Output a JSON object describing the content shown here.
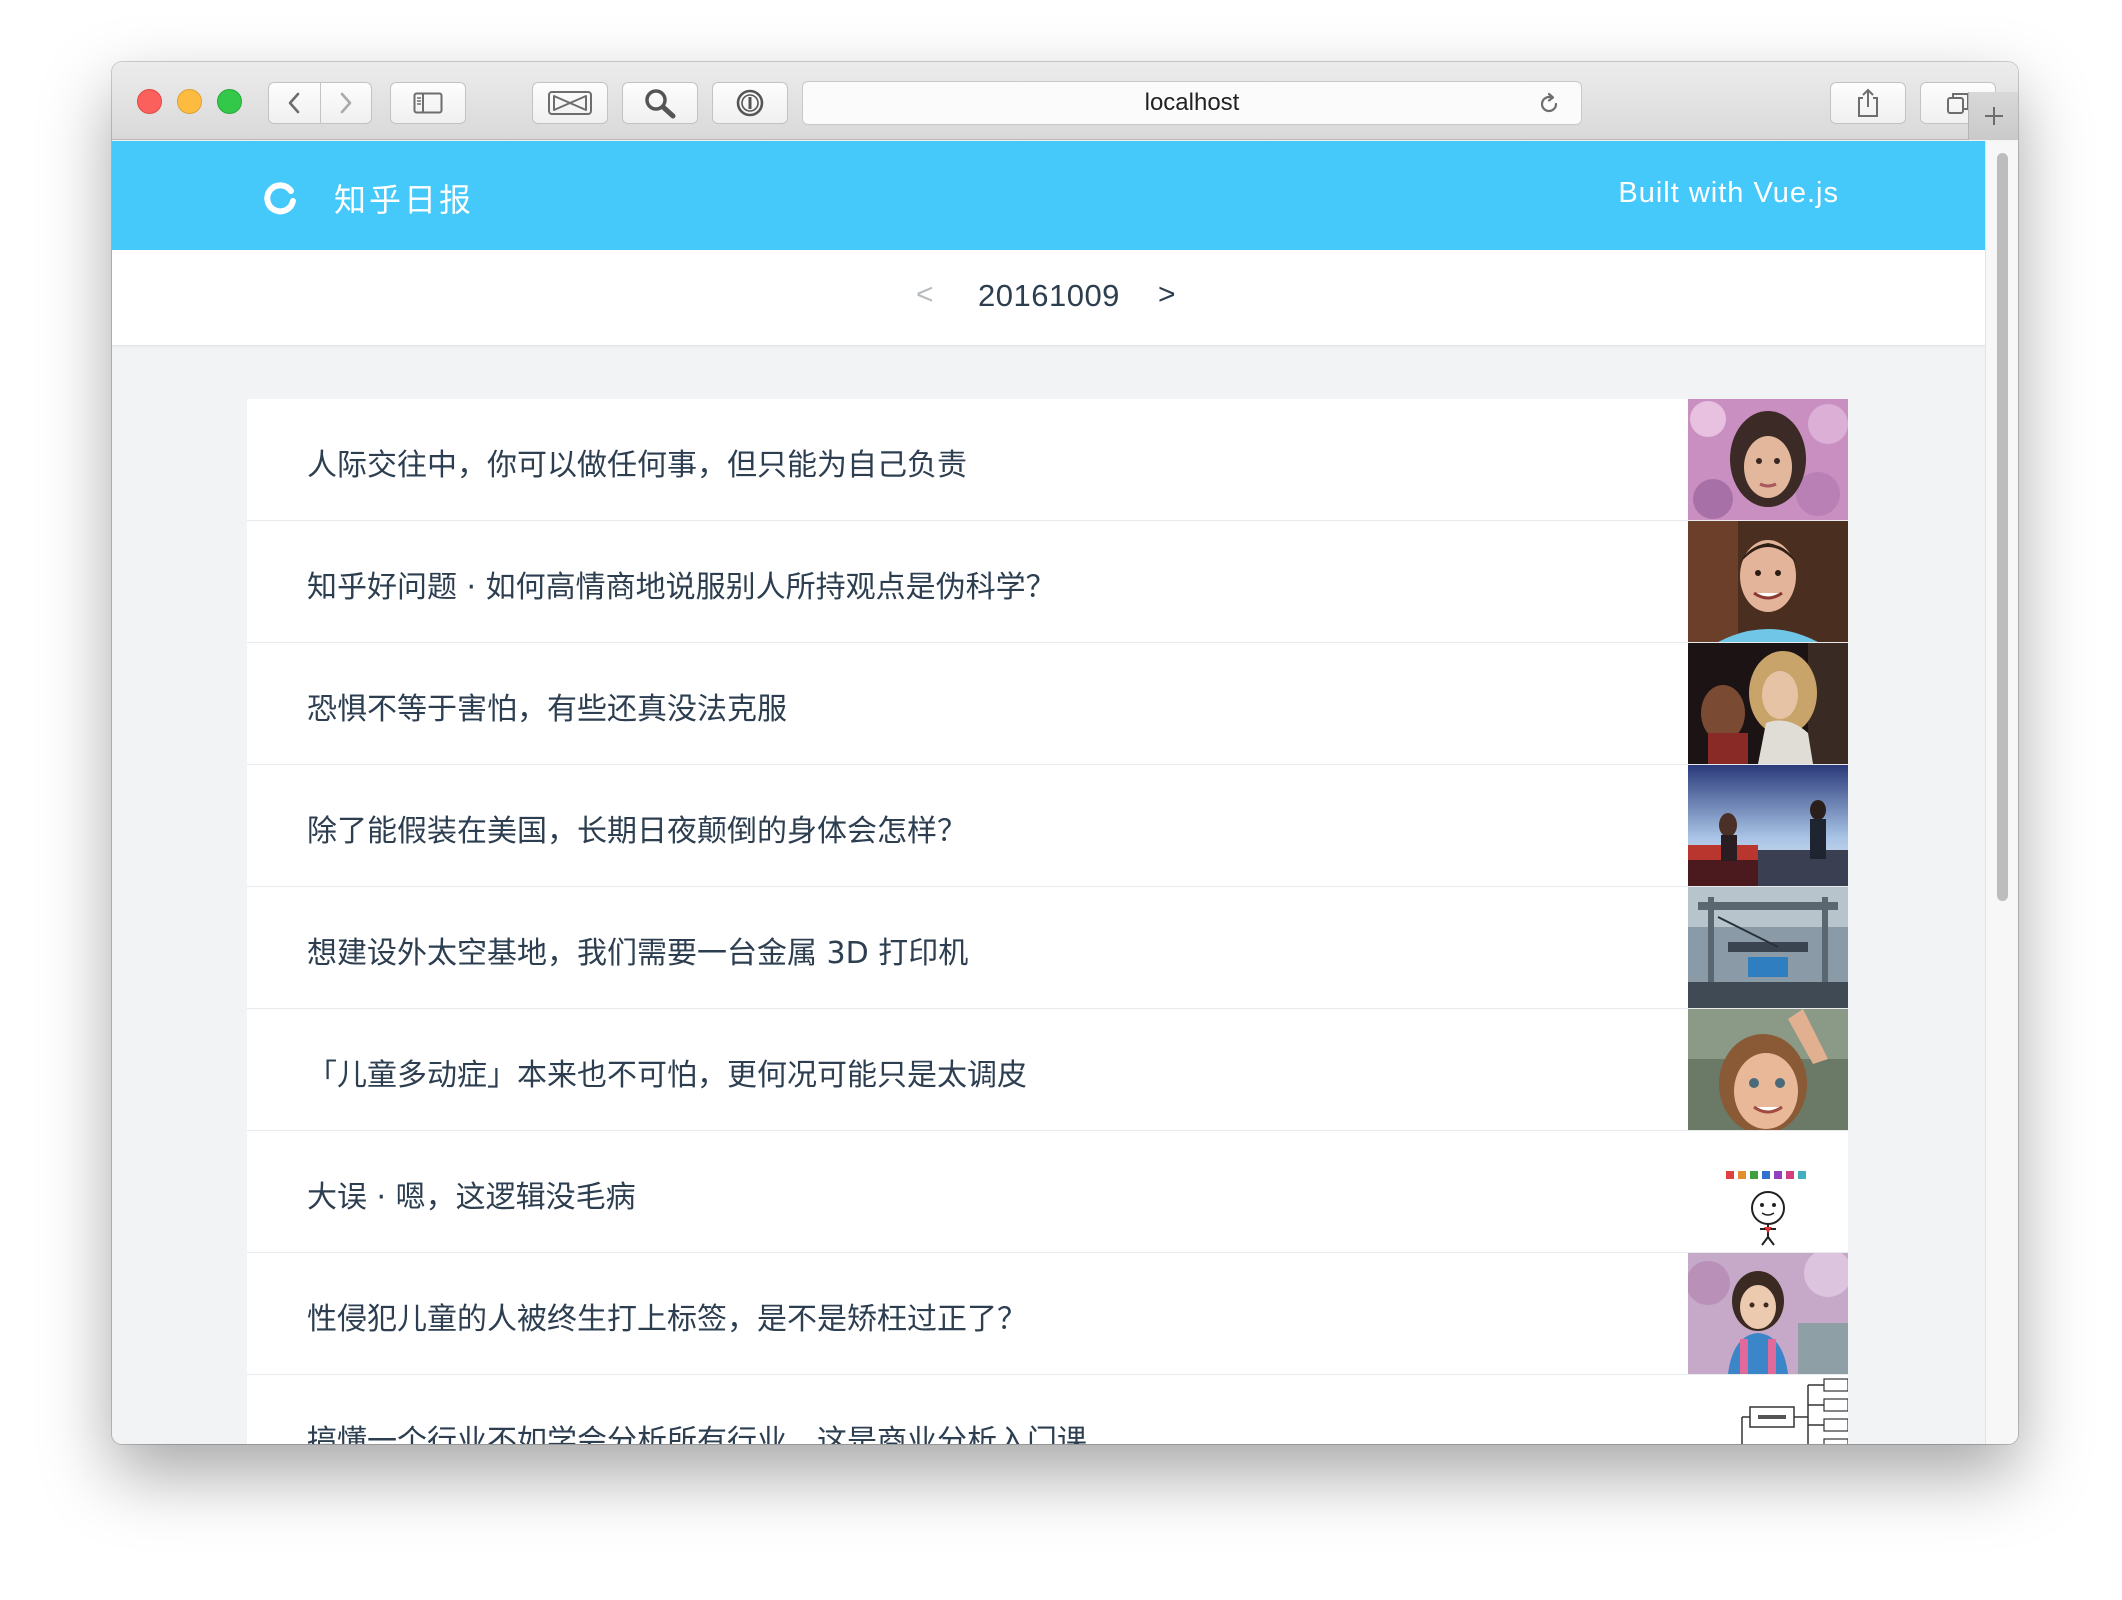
{
  "browser": {
    "url": "localhost"
  },
  "header": {
    "brand": "知乎日报",
    "built_with": "Built with Vue.js"
  },
  "datebar": {
    "prev": "<",
    "date": "20161009",
    "next": ">"
  },
  "stories": [
    {
      "title": "人际交往中，你可以做任何事，但只能为自己负责"
    },
    {
      "title": "知乎好问题 · 如何高情商地说服别人所持观点是伪科学？"
    },
    {
      "title": "恐惧不等于害怕，有些还真没法克服"
    },
    {
      "title": "除了能假装在美国，长期日夜颠倒的身体会怎样？"
    },
    {
      "title": "想建设外太空基地，我们需要一台金属 3D 打印机"
    },
    {
      "title": "「儿童多动症」本来也不可怕，更何况可能只是太调皮"
    },
    {
      "title": "大误 · 嗯，这逻辑没毛病"
    },
    {
      "title": "性侵犯儿童的人被终生打上标签，是不是矫枉过正了？"
    },
    {
      "title": "搞懂一个行业不如学会分析所有行业，这是商业分析入门课"
    }
  ],
  "colors": {
    "header_bg": "#45c8fa",
    "text": "#2c3e50",
    "page_bg": "#f2f3f5"
  }
}
